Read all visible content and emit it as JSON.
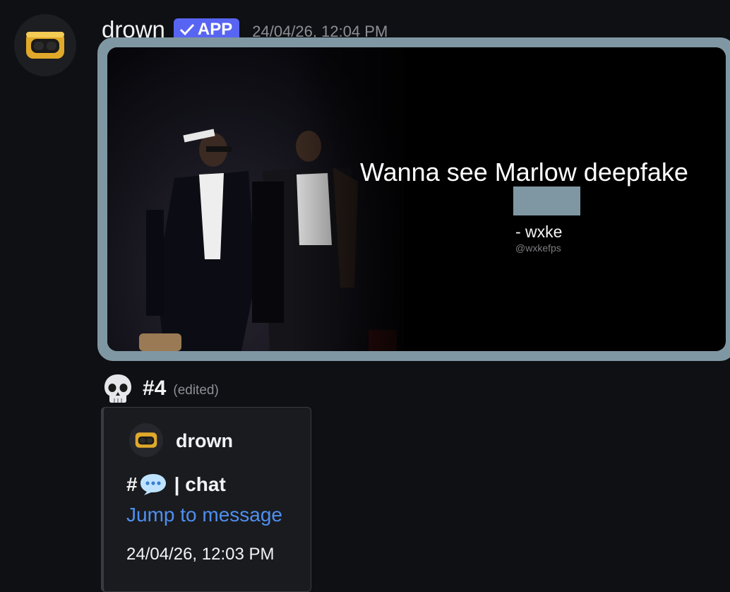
{
  "message": {
    "author": "drown",
    "badge": "APP",
    "timestamp": "24/04/26, 12:04 PM",
    "embed_image": {
      "quote": "Wanna see Marlow deepfake",
      "author": "- wxke",
      "handle": "@wxkefps"
    },
    "line": {
      "emoji_icon": "skull-icon",
      "text": "#4",
      "edited": "(edited)"
    },
    "quoted_card": {
      "author": "drown",
      "channel_hash": "#",
      "channel_icon": "speech-bubble-icon",
      "channel_name": "| chat",
      "link": "Jump to message",
      "timestamp": "24/04/26, 12:03 PM"
    }
  },
  "colors": {
    "background": "#0f1013",
    "frame": "#7f97a3",
    "badge": "#5865f2",
    "link": "#4e8ff0"
  }
}
